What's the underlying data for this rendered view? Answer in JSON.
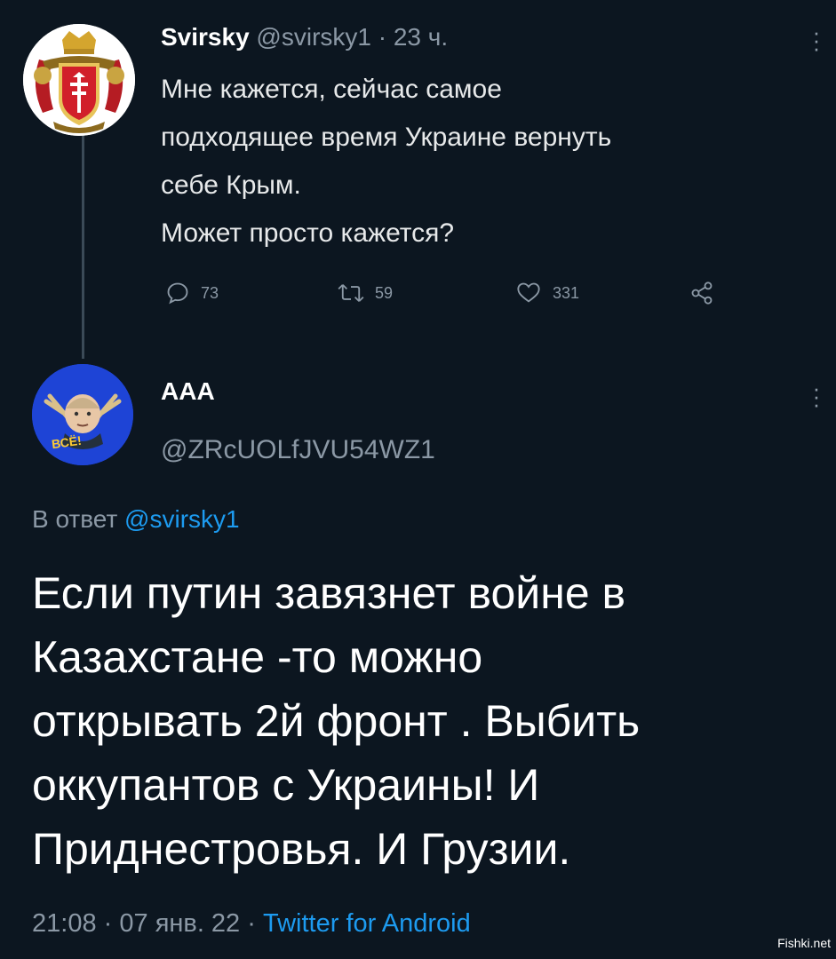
{
  "tweet1": {
    "name": "Svirsky",
    "handle": "@svirsky1",
    "separator": "·",
    "time": "23 ч.",
    "lines": [
      "Мне кажется, сейчас самое",
      "подходящее время Украине вернуть",
      "себе Крым.",
      "Может просто кажется?"
    ],
    "replies": "73",
    "retweets": "59",
    "likes": "331"
  },
  "tweet2": {
    "name": "AAA",
    "handle": "@ZRcUOLfJVU54WZ1",
    "avatar_text": "ВСЁ!",
    "reply_prefix": "В ответ",
    "reply_to": "@svirsky1",
    "lines": [
      "Если путин завязнет  войне в",
      "Казахстане -то можно",
      "открывать 2й фронт . Выбить",
      "оккупантов с Украины! И",
      "Приднестровья. И Грузии."
    ],
    "time": "21:08",
    "date": "07 янв. 22",
    "separator": "·",
    "app": "Twitter for Android"
  },
  "watermark": "Fishki.net",
  "icons": {
    "reply": "reply-icon",
    "retweet": "retweet-icon",
    "like": "heart-icon",
    "share": "share-icon",
    "more": "more-vertical-icon"
  },
  "colors": {
    "background": "#0c1620",
    "link": "#1d9bf0",
    "muted": "#8b98a5",
    "text": "#e7e9ea"
  }
}
